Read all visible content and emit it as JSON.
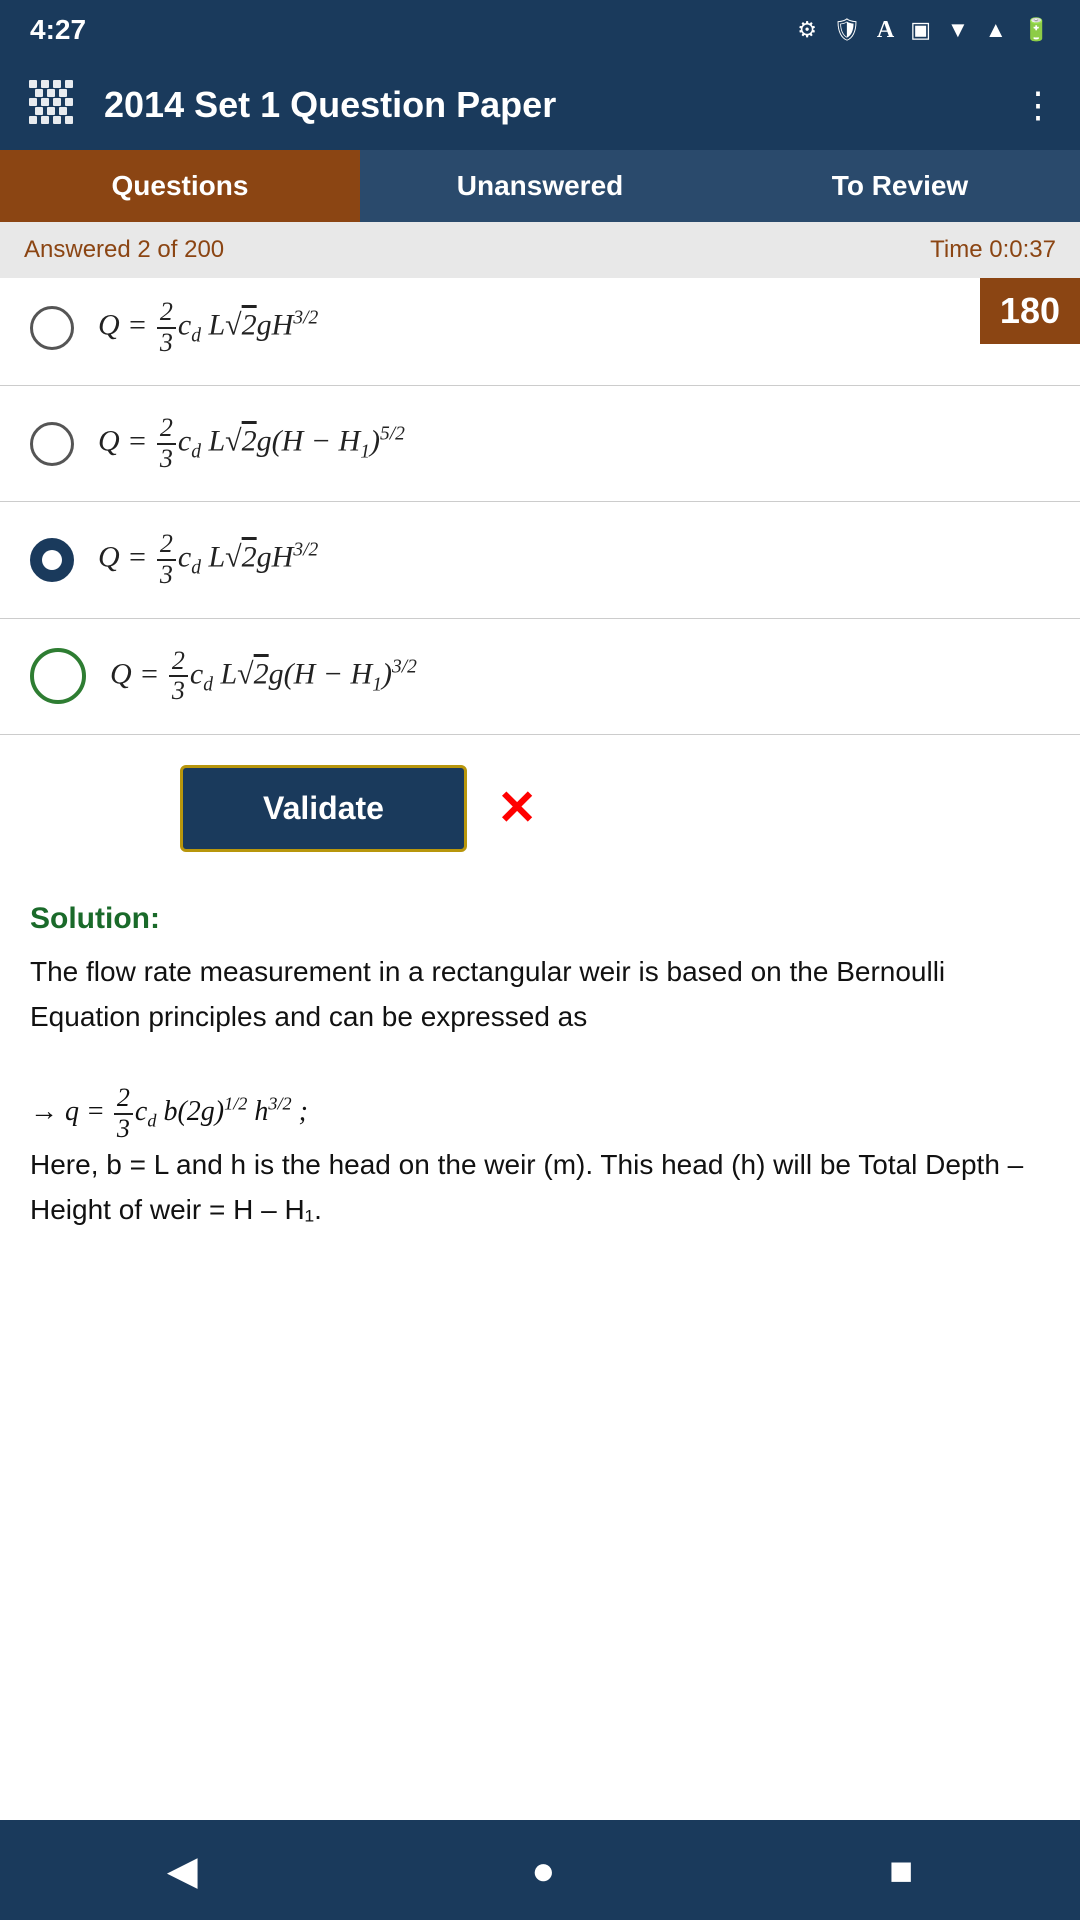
{
  "status_bar": {
    "time": "4:27",
    "icons": [
      "settings",
      "shield",
      "A",
      "phone"
    ]
  },
  "app_bar": {
    "title": "2014 Set 1 Question Paper",
    "menu_label": "⋮"
  },
  "tabs": [
    {
      "id": "questions",
      "label": "Questions",
      "active": true
    },
    {
      "id": "unanswered",
      "label": "Unanswered",
      "active": false
    },
    {
      "id": "to-review",
      "label": "To Review",
      "active": false
    }
  ],
  "progress": {
    "answered": "Answered 2 of 200",
    "time": "Time 0:0:37"
  },
  "question_number": "180",
  "options": [
    {
      "id": "opt1",
      "label": "Q = ²⁄₃ c_d L√(2g) H^(3/2)",
      "state": "none",
      "formula_html": "<i>Q</i> = <span class=\"formula-frac\"><span class=\"formula-num\">2</span><span class=\"formula-den\">3</span></span><i>c</i><sub>d</sub> L√<span style=\"text-decoration:overline\">2</span><i>g</i>H<sup>3/2</sup>"
    },
    {
      "id": "opt2",
      "label": "Q = 2/3 c_d L√2 g(H - H1)^(5/2)",
      "state": "none",
      "formula_html": "<i>Q</i> = <span class=\"formula-frac\"><span class=\"formula-num\">2</span><span class=\"formula-den\">3</span></span><i>c</i><sub>d</sub> L√<span style=\"text-decoration:overline\">2</span><i>g</i>(H − H<sub>1</sub>)<sup>5/2</sup>"
    },
    {
      "id": "opt3",
      "label": "Q = 2/3 c_d L√2 g H^(3/2)",
      "state": "selected-dark",
      "formula_html": "<i>Q</i> = <span class=\"formula-frac\"><span class=\"formula-num\">2</span><span class=\"formula-den\">3</span></span><i>c</i><sub>d</sub> L√<span style=\"text-decoration:overline\">2</span><i>g</i>H<sup>3/2</sup>"
    },
    {
      "id": "opt4",
      "label": "Q = 2/3 c_d L√2 g(H - H1)^(3/2)",
      "state": "selected-green",
      "formula_html": "<i>Q</i> = <span class=\"formula-frac\"><span class=\"formula-num\">2</span><span class=\"formula-den\">3</span></span><i>c</i><sub>d</sub> L√<span style=\"text-decoration:overline\">2</span><i>g</i>(H − H<sub>1</sub>)<sup>3/2</sup>"
    }
  ],
  "validate_btn": "Validate",
  "solution": {
    "title": "Solution:",
    "text": "The flow rate measurement in a rectangular weir is based on the Bernoulli Equation principles and can be expressed as",
    "formula": "→ q = ²⁄₃ c_d b(2g)^(1/2) h^(3/2) ;",
    "text2": "Here, b = L and h is the head on the weir (m). This head (h) will be Total Depth – Height of weir = H – H₁."
  },
  "bottom_nav": {
    "back": "◀",
    "home": "●",
    "square": "■"
  }
}
